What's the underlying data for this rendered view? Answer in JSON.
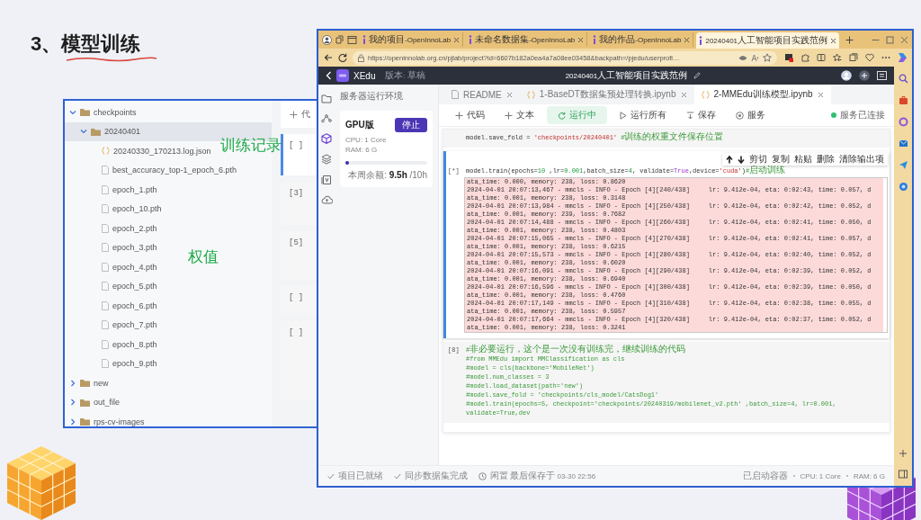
{
  "slide": {
    "title": "3、模型训练"
  },
  "file_browser": {
    "tree": [
      {
        "name": "checkpoints",
        "kind": "folder",
        "expanded": true,
        "selected": false,
        "children": [
          {
            "name": "20240401",
            "kind": "folder",
            "expanded": true,
            "selected": true,
            "children": [
              {
                "name": "20240330_170213.log.json",
                "kind": "json",
                "selected": false
              },
              {
                "name": "best_accuracy_top-1_epoch_6.pth",
                "kind": "file",
                "selected": false
              },
              {
                "name": "epoch_1.pth",
                "kind": "file",
                "selected": false
              },
              {
                "name": "epoch_10.pth",
                "kind": "file",
                "selected": false
              },
              {
                "name": "epoch_2.pth",
                "kind": "file",
                "selected": false
              },
              {
                "name": "epoch_3.pth",
                "kind": "file",
                "selected": false
              },
              {
                "name": "epoch_4.pth",
                "kind": "file",
                "selected": false
              },
              {
                "name": "epoch_5.pth",
                "kind": "file",
                "selected": false
              },
              {
                "name": "epoch_6.pth",
                "kind": "file",
                "selected": false
              },
              {
                "name": "epoch_7.pth",
                "kind": "file",
                "selected": false
              },
              {
                "name": "epoch_8.pth",
                "kind": "file",
                "selected": false
              },
              {
                "name": "epoch_9.pth",
                "kind": "file",
                "selected": false
              }
            ]
          }
        ]
      },
      {
        "name": "new",
        "kind": "folder",
        "expanded": false,
        "selected": false
      },
      {
        "name": "out_file",
        "kind": "folder",
        "expanded": false,
        "selected": false
      },
      {
        "name": "rps-cv-images",
        "kind": "folder",
        "expanded": false,
        "selected": false
      }
    ],
    "editor_peek": {
      "add_label": "代",
      "cells": [
        {
          "prompt": "[ ]",
          "active": true
        },
        {
          "prompt": "[3]",
          "active": false
        },
        {
          "prompt": "[5]",
          "active": false
        },
        {
          "prompt": "[ ]",
          "active": false
        },
        {
          "prompt": "[ ]",
          "active": false
        }
      ]
    }
  },
  "annotations": [
    {
      "text": "训练记录"
    },
    {
      "text": "权值"
    }
  ],
  "browser": {
    "tabs": [
      {
        "title": "我的项目-OpenInnoLab",
        "selected": false
      },
      {
        "title": "未命名数据集-OpenInnoLab",
        "selected": false
      },
      {
        "title": "我的作品-OpenInnoLab",
        "selected": false
      },
      {
        "title": "20240401人工智能项目实践范例",
        "selected": true
      }
    ],
    "url": "https://openinnolab.org.cn/pjlab/project?id=6607b182a0ea4a7a08ee03458&backpath=/pjedu/userprofi…",
    "app": {
      "brand": "XEdu",
      "version": "版本: 草稿",
      "project_title": "20240401人工智能项目实践范例",
      "rail": [
        {
          "kind": "folder",
          "selected": false
        },
        {
          "kind": "graph",
          "selected": false
        },
        {
          "kind": "cube",
          "selected": true
        },
        {
          "kind": "layers",
          "selected": false
        },
        {
          "kind": "vbox",
          "selected": false
        },
        {
          "kind": "cloud",
          "selected": false
        }
      ],
      "env": {
        "heading": "服务器运行环境",
        "plan": "GPU版",
        "stop_label": "停止",
        "cpu": "CPU: 1 Core",
        "ram": "RAM: 6 G",
        "level": 0.04,
        "usage": "本周余额: **9.5h** /10h"
      },
      "notebook_tabs": [
        {
          "title": "README",
          "kind": "doc",
          "selected": false
        },
        {
          "title": "1-BaseDT数据集预处理转换.ipynb",
          "kind": "notebook",
          "selected": false
        },
        {
          "title": "2-MMEdu训练模型.ipynb",
          "kind": "notebook",
          "selected": true
        }
      ],
      "toolbar": [
        {
          "label": "代码",
          "kind": "plus"
        },
        {
          "label": "文本",
          "kind": "plus"
        },
        {
          "label": "运行中",
          "kind": "running"
        },
        {
          "label": "运行所有",
          "kind": "run"
        },
        {
          "label": "保存",
          "kind": "save"
        },
        {
          "label": "服务",
          "kind": "service"
        }
      ],
      "connection": "服务已连接",
      "cells": [
        {
          "active": false,
          "lines": [
            [
              {
                "kind": "plain",
                "text": "model.save_fold = "
              },
              {
                "kind": "string",
                "text": "'checkpoints/20240401'"
              },
              {
                "kind": "comment",
                "text": " #训练的权重文件保存位置"
              }
            ]
          ]
        },
        {
          "prompt": "[*]",
          "active": true,
          "actions": [
            "剪切",
            "复制",
            "粘贴",
            "删除",
            "清除输出项"
          ],
          "lines": [
            [
              {
                "kind": "plain",
                "text": "model.train(epochs="
              },
              {
                "kind": "number",
                "text": "10"
              },
              {
                "kind": "plain",
                "text": " ,lr="
              },
              {
                "kind": "number",
                "text": "0.001"
              },
              {
                "kind": "plain",
                "text": ",batch_size="
              },
              {
                "kind": "number",
                "text": "4"
              },
              {
                "kind": "plain",
                "text": ", validate="
              },
              {
                "kind": "keyword",
                "text": "True"
              },
              {
                "kind": "plain",
                "text": ",device="
              },
              {
                "kind": "string",
                "text": "'cuda'"
              },
              {
                "kind": "plain",
                "text": ")"
              },
              {
                "kind": "comment",
                "text": "#启动训练"
              }
            ]
          ],
          "output": [
            "ata_time: 0.000, memory: 238, loss: 0.8620",
            "2024-04-01 20:07:13,467 - mmcls - INFO - Epoch [4][240/438]     lr: 9.412e-04, eta: 0:02:43, time: 0.057, d",
            "ata_time: 0.001, memory: 238, loss: 0.3148",
            "2024-04-01 20:07:13,984 - mmcls - INFO - Epoch [4][250/438]     lr: 9.412e-04, eta: 0:02:42, time: 0.052, d",
            "ata_time: 0.001, memory: 239, loss: 0.7682",
            "2024-04-01 20:07:14,488 - mmcls - INFO - Epoch [4][260/438]     lr: 9.412e-04, eta: 0:02:41, time: 0.050, d",
            "ata_time: 0.001, memory: 238, loss: 0.4803",
            "2024-04-01 20:07:15,065 - mmcls - INFO - Epoch [4][270/438]     lr: 9.412e-04, eta: 0:02:41, time: 0.057, d",
            "ata_time: 0.001, memory: 238, loss: 0.6215",
            "2024-04-01 20:07:15,573 - mmcls - INFO - Epoch [4][280/438]     lr: 9.412e-04, eta: 0:02:40, time: 0.052, d",
            "ata_time: 0.001, memory: 238, loss: 0.6020",
            "2024-04-01 20:07:16,091 - mmcls - INFO - Epoch [4][290/438]     lr: 9.412e-04, eta: 0:02:39, time: 0.052, d",
            "ata_time: 0.001, memory: 238, loss: 0.6940",
            "2024-04-01 20:07:16,596 - mmcls - INFO - Epoch [4][300/438]     lr: 9.412e-04, eta: 0:02:39, time: 0.050, d",
            "ata_time: 0.001, memory: 238, loss: 0.4760",
            "2024-04-01 20:07:17,149 - mmcls - INFO - Epoch [4][310/438]     lr: 9.412e-04, eta: 0:02:38, time: 0.055, d",
            "ata_time: 0.001, memory: 238, loss: 0.5957",
            "2024-04-01 20:07:17,664 - mmcls - INFO - Epoch [4][320/438]     lr: 9.412e-04, eta: 0:02:37, time: 0.052, d",
            "ata_time: 0.001, memory: 238, loss: 0.3241"
          ]
        },
        {
          "prompt": "[8]",
          "active": false,
          "lines": [
            [
              {
                "kind": "comment",
                "text": "#非必要运行，这个是一次没有训练完，继续训练的代码"
              }
            ],
            [
              {
                "kind": "comment",
                "text": "#from MMEdu import MMClassification as cls"
              }
            ],
            [
              {
                "kind": "comment",
                "text": "#model = cls(backbone='MobileNet')"
              }
            ],
            [
              {
                "kind": "comment",
                "text": "#model.num_classes = 3"
              }
            ],
            [
              {
                "kind": "comment",
                "text": "#model.load_dataset(path='new')"
              }
            ],
            [
              {
                "kind": "comment",
                "text": "#model.save_fold = 'checkpoints/cls_model/CatsDog1'"
              }
            ],
            [
              {
                "kind": "comment",
                "text": "#model.train(epochs=5, checkpoint='checkpoints/20240319/mobilenet_v2.pth' ,batch_size=4, lr=0.001, validate=True,dev"
              }
            ]
          ]
        }
      ],
      "status_bar": {
        "left": [
          {
            "kind": "check",
            "text": "项目已就绪"
          },
          {
            "kind": "check",
            "text": "同步数据集完成"
          },
          {
            "kind": "clock",
            "text": "闲置 最后保存于 03-30 22:56"
          }
        ],
        "right": [
          "已启动容器",
          "CPU: 1 Core",
          "RAM: 6 G"
        ]
      }
    }
  }
}
